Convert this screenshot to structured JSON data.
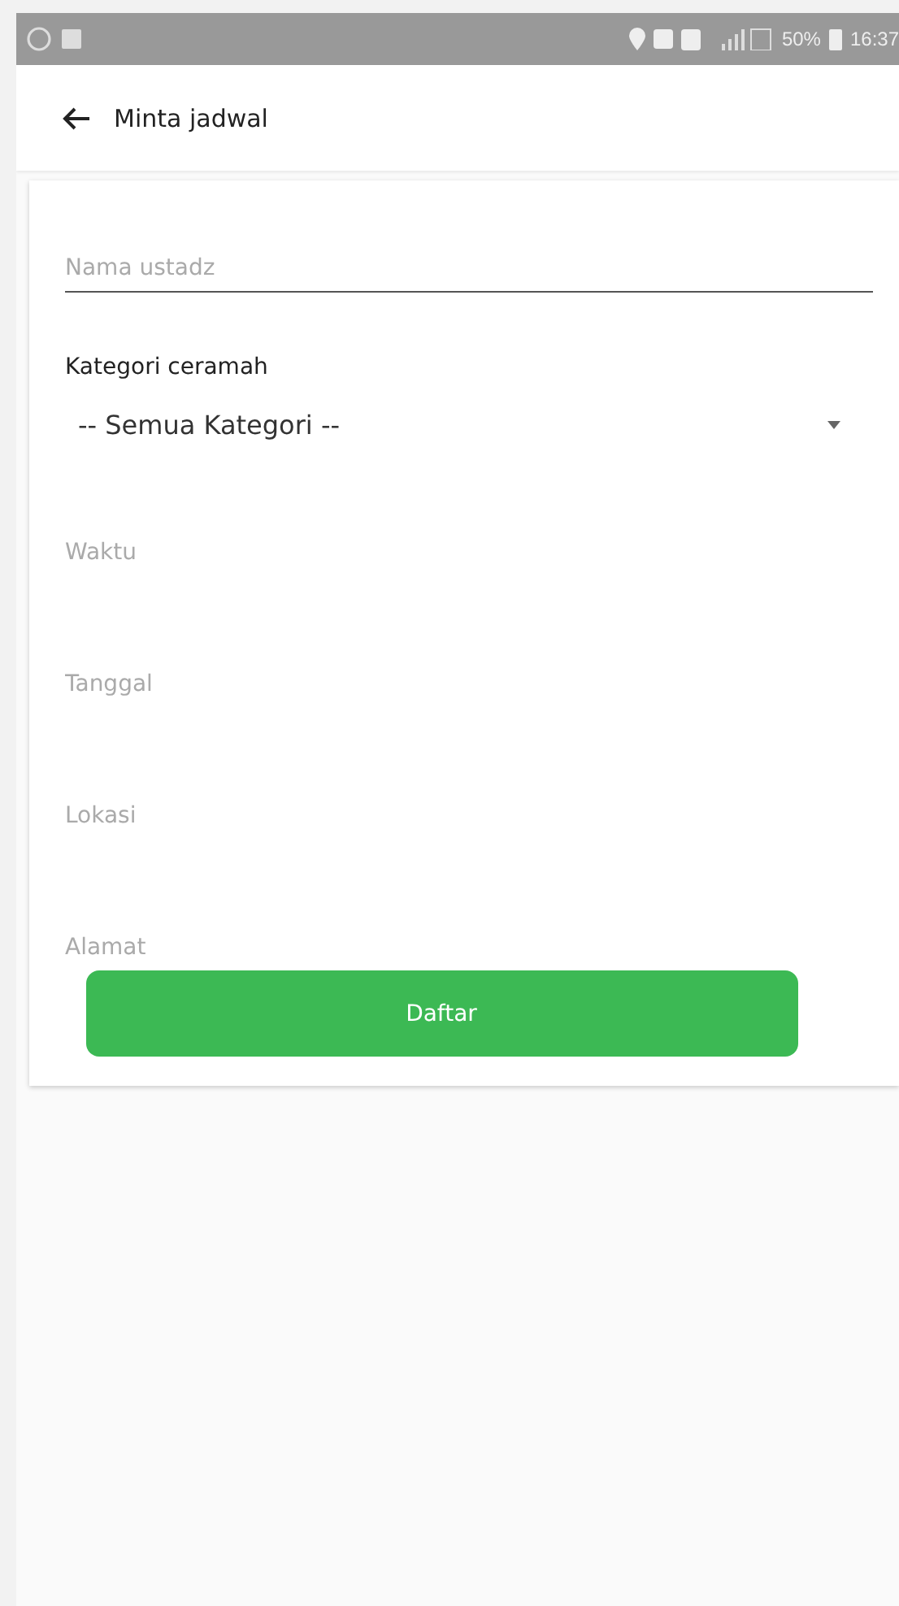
{
  "status_bar": {
    "battery": "50%",
    "time": "16:37"
  },
  "app_bar": {
    "title": "Minta jadwal"
  },
  "form": {
    "name_field": {
      "placeholder": "Nama ustadz"
    },
    "category": {
      "label": "Kategori ceramah",
      "value": "-- Semua Kategori --"
    },
    "fields": [
      {
        "placeholder": "Waktu"
      },
      {
        "placeholder": "Tanggal"
      },
      {
        "placeholder": "Lokasi"
      },
      {
        "placeholder": "Alamat"
      }
    ],
    "submit": "Daftar"
  }
}
